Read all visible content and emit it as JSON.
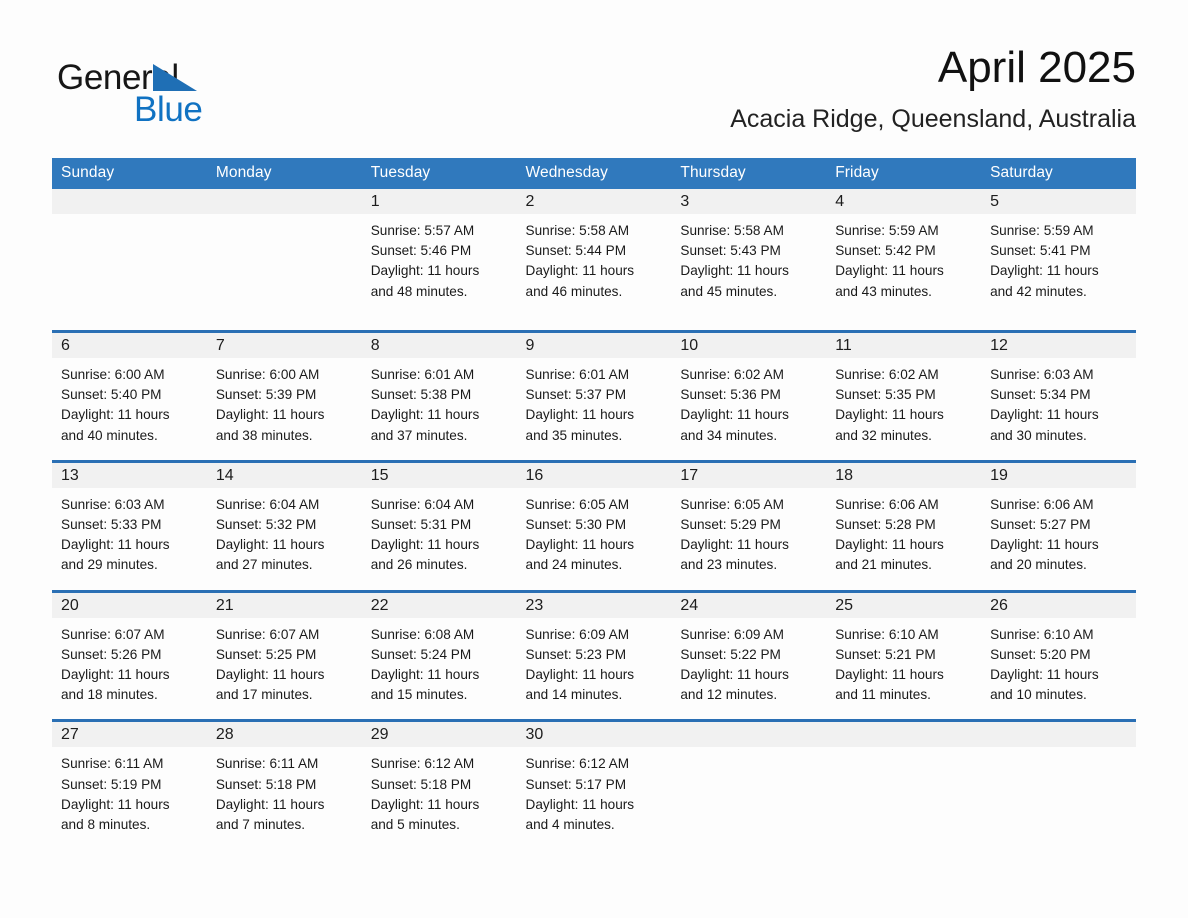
{
  "brand": {
    "word1": "General",
    "word2": "Blue",
    "triangle_color": "#1f6fb5",
    "blue_color": "#1072c2",
    "logo_icon": "triangle-icon"
  },
  "header": {
    "month_title": "April 2025",
    "location": "Acacia Ridge, Queensland, Australia"
  },
  "theme": {
    "header_blue": "#3079bd",
    "divider_blue": "#2a6fb4",
    "daynum_band": "#f1f1f1",
    "page_bg": "#fdfdfd",
    "text": "#1a1a1a"
  },
  "weekday_headers": [
    "Sunday",
    "Monday",
    "Tuesday",
    "Wednesday",
    "Thursday",
    "Friday",
    "Saturday"
  ],
  "weeks": [
    [
      {
        "day": "",
        "lines": []
      },
      {
        "day": "",
        "lines": []
      },
      {
        "day": "1",
        "lines": [
          "Sunrise: 5:57 AM",
          "Sunset: 5:46 PM",
          "Daylight: 11 hours",
          "and 48 minutes."
        ]
      },
      {
        "day": "2",
        "lines": [
          "Sunrise: 5:58 AM",
          "Sunset: 5:44 PM",
          "Daylight: 11 hours",
          "and 46 minutes."
        ]
      },
      {
        "day": "3",
        "lines": [
          "Sunrise: 5:58 AM",
          "Sunset: 5:43 PM",
          "Daylight: 11 hours",
          "and 45 minutes."
        ]
      },
      {
        "day": "4",
        "lines": [
          "Sunrise: 5:59 AM",
          "Sunset: 5:42 PM",
          "Daylight: 11 hours",
          "and 43 minutes."
        ]
      },
      {
        "day": "5",
        "lines": [
          "Sunrise: 5:59 AM",
          "Sunset: 5:41 PM",
          "Daylight: 11 hours",
          "and 42 minutes."
        ]
      }
    ],
    [
      {
        "day": "6",
        "lines": [
          "Sunrise: 6:00 AM",
          "Sunset: 5:40 PM",
          "Daylight: 11 hours",
          "and 40 minutes."
        ]
      },
      {
        "day": "7",
        "lines": [
          "Sunrise: 6:00 AM",
          "Sunset: 5:39 PM",
          "Daylight: 11 hours",
          "and 38 minutes."
        ]
      },
      {
        "day": "8",
        "lines": [
          "Sunrise: 6:01 AM",
          "Sunset: 5:38 PM",
          "Daylight: 11 hours",
          "and 37 minutes."
        ]
      },
      {
        "day": "9",
        "lines": [
          "Sunrise: 6:01 AM",
          "Sunset: 5:37 PM",
          "Daylight: 11 hours",
          "and 35 minutes."
        ]
      },
      {
        "day": "10",
        "lines": [
          "Sunrise: 6:02 AM",
          "Sunset: 5:36 PM",
          "Daylight: 11 hours",
          "and 34 minutes."
        ]
      },
      {
        "day": "11",
        "lines": [
          "Sunrise: 6:02 AM",
          "Sunset: 5:35 PM",
          "Daylight: 11 hours",
          "and 32 minutes."
        ]
      },
      {
        "day": "12",
        "lines": [
          "Sunrise: 6:03 AM",
          "Sunset: 5:34 PM",
          "Daylight: 11 hours",
          "and 30 minutes."
        ]
      }
    ],
    [
      {
        "day": "13",
        "lines": [
          "Sunrise: 6:03 AM",
          "Sunset: 5:33 PM",
          "Daylight: 11 hours",
          "and 29 minutes."
        ]
      },
      {
        "day": "14",
        "lines": [
          "Sunrise: 6:04 AM",
          "Sunset: 5:32 PM",
          "Daylight: 11 hours",
          "and 27 minutes."
        ]
      },
      {
        "day": "15",
        "lines": [
          "Sunrise: 6:04 AM",
          "Sunset: 5:31 PM",
          "Daylight: 11 hours",
          "and 26 minutes."
        ]
      },
      {
        "day": "16",
        "lines": [
          "Sunrise: 6:05 AM",
          "Sunset: 5:30 PM",
          "Daylight: 11 hours",
          "and 24 minutes."
        ]
      },
      {
        "day": "17",
        "lines": [
          "Sunrise: 6:05 AM",
          "Sunset: 5:29 PM",
          "Daylight: 11 hours",
          "and 23 minutes."
        ]
      },
      {
        "day": "18",
        "lines": [
          "Sunrise: 6:06 AM",
          "Sunset: 5:28 PM",
          "Daylight: 11 hours",
          "and 21 minutes."
        ]
      },
      {
        "day": "19",
        "lines": [
          "Sunrise: 6:06 AM",
          "Sunset: 5:27 PM",
          "Daylight: 11 hours",
          "and 20 minutes."
        ]
      }
    ],
    [
      {
        "day": "20",
        "lines": [
          "Sunrise: 6:07 AM",
          "Sunset: 5:26 PM",
          "Daylight: 11 hours",
          "and 18 minutes."
        ]
      },
      {
        "day": "21",
        "lines": [
          "Sunrise: 6:07 AM",
          "Sunset: 5:25 PM",
          "Daylight: 11 hours",
          "and 17 minutes."
        ]
      },
      {
        "day": "22",
        "lines": [
          "Sunrise: 6:08 AM",
          "Sunset: 5:24 PM",
          "Daylight: 11 hours",
          "and 15 minutes."
        ]
      },
      {
        "day": "23",
        "lines": [
          "Sunrise: 6:09 AM",
          "Sunset: 5:23 PM",
          "Daylight: 11 hours",
          "and 14 minutes."
        ]
      },
      {
        "day": "24",
        "lines": [
          "Sunrise: 6:09 AM",
          "Sunset: 5:22 PM",
          "Daylight: 11 hours",
          "and 12 minutes."
        ]
      },
      {
        "day": "25",
        "lines": [
          "Sunrise: 6:10 AM",
          "Sunset: 5:21 PM",
          "Daylight: 11 hours",
          "and 11 minutes."
        ]
      },
      {
        "day": "26",
        "lines": [
          "Sunrise: 6:10 AM",
          "Sunset: 5:20 PM",
          "Daylight: 11 hours",
          "and 10 minutes."
        ]
      }
    ],
    [
      {
        "day": "27",
        "lines": [
          "Sunrise: 6:11 AM",
          "Sunset: 5:19 PM",
          "Daylight: 11 hours",
          "and 8 minutes."
        ]
      },
      {
        "day": "28",
        "lines": [
          "Sunrise: 6:11 AM",
          "Sunset: 5:18 PM",
          "Daylight: 11 hours",
          "and 7 minutes."
        ]
      },
      {
        "day": "29",
        "lines": [
          "Sunrise: 6:12 AM",
          "Sunset: 5:18 PM",
          "Daylight: 11 hours",
          "and 5 minutes."
        ]
      },
      {
        "day": "30",
        "lines": [
          "Sunrise: 6:12 AM",
          "Sunset: 5:17 PM",
          "Daylight: 11 hours",
          "and 4 minutes."
        ]
      },
      {
        "day": "",
        "lines": []
      },
      {
        "day": "",
        "lines": []
      },
      {
        "day": "",
        "lines": []
      }
    ]
  ]
}
